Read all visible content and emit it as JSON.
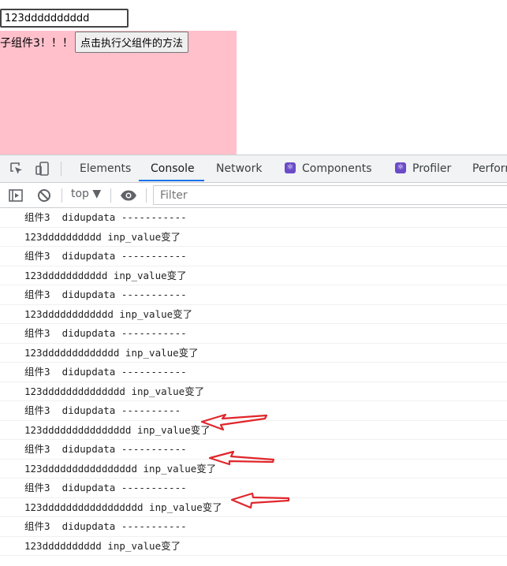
{
  "page": {
    "input_value": "123dddddddddd",
    "child_label": "子组件3！！！",
    "child_button": "点击执行父组件的方法"
  },
  "devtools": {
    "tabs": [
      {
        "label": "Elements"
      },
      {
        "label": "Console",
        "active": true
      },
      {
        "label": "Network"
      },
      {
        "label": "Components",
        "icon": "react-icon"
      },
      {
        "label": "Profiler",
        "icon": "react-icon"
      },
      {
        "label": "Perforr"
      }
    ],
    "toolbar": {
      "context": "top ▼",
      "filter_placeholder": "Filter"
    },
    "logs": [
      "组件3  didupdata -----------",
      "123dddddddddd inp_value变了",
      "组件3  didupdata -----------",
      "123ddddddddddd inp_value变了",
      "组件3  didupdata -----------",
      "123dddddddddddd inp_value变了",
      "组件3  didupdata -----------",
      "123ddddddddddddd inp_value变了",
      "组件3  didupdata -----------",
      "123dddddddddddddd inp_value变了",
      "组件3  didupdata ----------",
      "123ddddddddddddddd inp_value变了",
      "组件3  didupdata -----------",
      "123dddddddddddddddd inp_value变了",
      "组件3  didupdata -----------",
      "123ddddddddddddddddd inp_value变了",
      "组件3  didupdata -----------",
      "123dddddddddd inp_value变了"
    ],
    "colors": {
      "accent": "#1a73e8",
      "annotation_arrow": "#e0262b",
      "pink_bg": "#ffc0cb"
    }
  }
}
